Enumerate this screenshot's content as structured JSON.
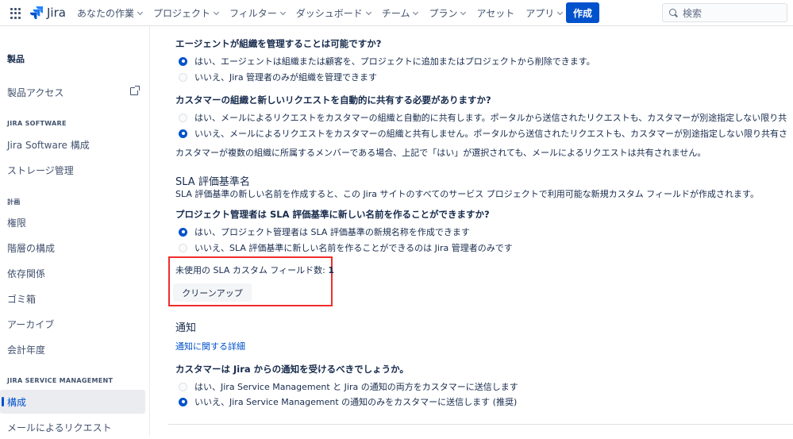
{
  "topbar": {
    "product": "Jira",
    "nav": [
      {
        "label": "あなたの作業",
        "chevron": true
      },
      {
        "label": "プロジェクト",
        "chevron": true
      },
      {
        "label": "フィルター",
        "chevron": true
      },
      {
        "label": "ダッシュボード",
        "chevron": true
      },
      {
        "label": "チーム",
        "chevron": true
      },
      {
        "label": "プラン",
        "chevron": true
      },
      {
        "label": "アセット",
        "chevron": false
      },
      {
        "label": "アプリ",
        "chevron": true
      }
    ],
    "create_label": "作成",
    "search_placeholder": "検索"
  },
  "sidebar": {
    "title": "製品",
    "product_access": "製品アクセス",
    "section_software": "JIRA SOFTWARE",
    "software_config": "Jira Software 構成",
    "storage": "ストレージ管理",
    "section_plan": "計画",
    "permissions": "権限",
    "hierarchy": "階層の構成",
    "dependencies": "依存関係",
    "trash": "ゴミ箱",
    "archive": "アーカイブ",
    "fiscal_year": "会計年度",
    "section_jsm": "JIRA SERVICE MANAGEMENT",
    "config": "構成",
    "email_requests": "メールによるリクエスト"
  },
  "main": {
    "q1": "エージェントが組織を管理することは可能ですか?",
    "q1_opt1": "はい、エージェントは組織または顧客を、プロジェクトに追加またはプロジェクトから削除できます。",
    "q1_opt2": "いいえ、Jira 管理者のみが組織を管理できます",
    "q2": "カスタマーの組織と新しいリクエストを自動的に共有する必要がありますか?",
    "q2_opt1": "はい、メールによるリクエストをカスタマーの組織と自動的に共有します。ポータルから送信されたリクエストも、カスタマーが別途指定しない限り共",
    "q2_opt2": "いいえ、メールによるリクエストをカスタマーの組織と共有しません。ポータルから送信されたリクエストも、カスタマーが別途指定しない限り共有さ",
    "q2_note": "カスタマーが複数の組織に所属するメンバーである場合、上記で「はい」が選択されても、メールによるリクエストは共有されません。",
    "sla_heading": "SLA 評価基準名",
    "sla_desc": "SLA 評価基準の新しい名前を作成すると、この Jira サイトのすべてのサービス プロジェクトで利用可能な新規カスタム フィールドが作成されます。",
    "q3": "プロジェクト管理者は SLA 評価基準に新しい名前を作ることができますか?",
    "q3_opt1": "はい、プロジェクト管理者は SLA 評価基準の新規名称を作成できます",
    "q3_opt2": "いいえ、SLA 評価基準に新しい名前を作ることができるのは Jira 管理者のみです",
    "unused_label": "未使用の SLA カスタム フィールド数: ",
    "unused_count": "1",
    "cleanup_button": "クリーンアップ",
    "notify_heading": "通知",
    "notify_link": "通知に関する詳細",
    "q4": "カスタマーは Jira からの通知を受けるべきでしょうか。",
    "q4_opt1": "はい、Jira Service Management と Jira の通知の両方をカスタマーに送信します",
    "q4_opt2": "いいえ、Jira Service Management の通知のみをカスタマーに送信します (推奨)"
  },
  "colors": {
    "accent": "#0052cc",
    "highlight_box": "#ef2d2d"
  }
}
